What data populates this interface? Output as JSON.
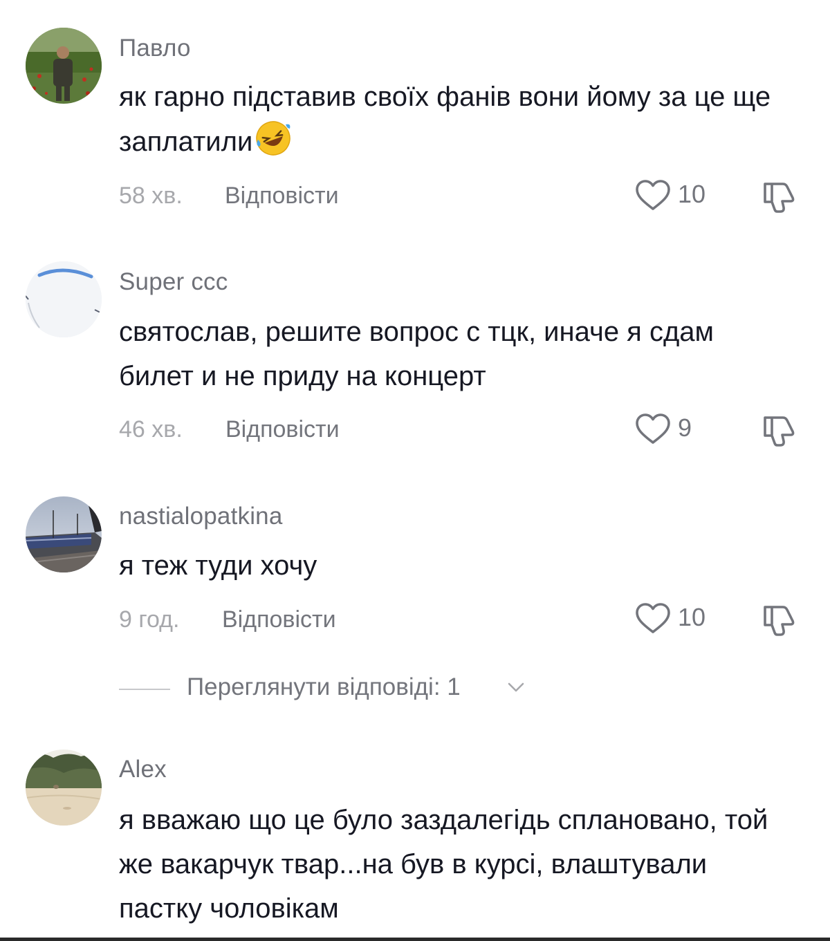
{
  "actions": {
    "reply_label": "Відповісти"
  },
  "comments": [
    {
      "username": "Павло",
      "text": "як гарно підставив своїх фанів вони йому за це ще заплатили",
      "emoji": "rolling-on-floor-laughing-emoji",
      "time": "58 хв.",
      "likes": "10"
    },
    {
      "username": "Super ccc",
      "text": "святослав, решите вопрос с тцк, иначе я сдам билет и не приду на концерт",
      "time": "46 хв.",
      "likes": "9"
    },
    {
      "username": "nastialopatkina",
      "text": "я теж туди хочу",
      "time": "9 год.",
      "likes": "10"
    },
    {
      "username": "Alex",
      "text": "я вважаю що це було заздалегідь сплановано, той же вакарчук твар...на був в курсі, влаштували пастку чоловікам"
    }
  ],
  "view_replies": {
    "label": "Переглянути відповіді: 1"
  },
  "colors": {
    "text": "#161823",
    "secondary": "#73757c",
    "timestamp": "#a7a8ac"
  }
}
